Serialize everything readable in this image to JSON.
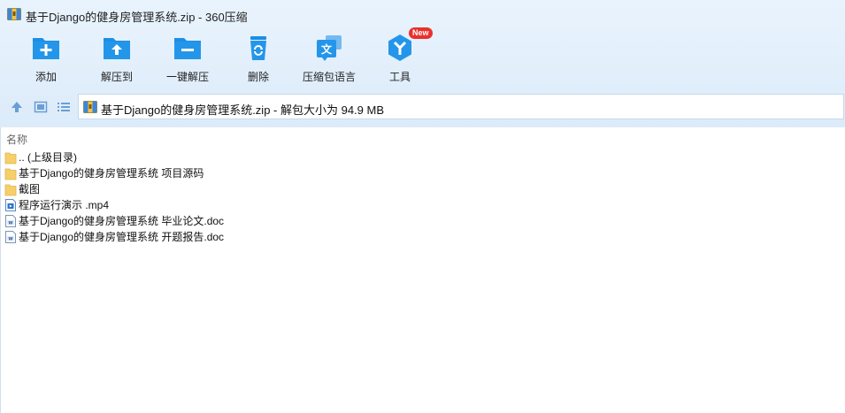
{
  "window": {
    "title": "基于Django的健身房管理系统.zip - 360压缩"
  },
  "toolbar": {
    "buttons": [
      {
        "label": "添加",
        "icon": "add-folder-icon"
      },
      {
        "label": "解压到",
        "icon": "extract-to-icon"
      },
      {
        "label": "一键解压",
        "icon": "one-click-extract-icon"
      },
      {
        "label": "删除",
        "icon": "delete-bin-icon"
      },
      {
        "label": "压缩包语言",
        "icon": "archive-language-icon"
      },
      {
        "label": "工具",
        "icon": "tools-icon",
        "badge": "New"
      }
    ]
  },
  "address": {
    "text": "基于Django的健身房管理系统.zip - 解包大小为 94.9 MB"
  },
  "list": {
    "header": "名称",
    "items": [
      {
        "name": ".. (上级目录)",
        "type": "folder",
        "icon": "folder-icon"
      },
      {
        "name": "基于Django的健身房管理系统 项目源码",
        "type": "folder",
        "icon": "folder-icon"
      },
      {
        "name": "截图",
        "type": "folder",
        "icon": "folder-icon"
      },
      {
        "name": "程序运行演示  .mp4",
        "type": "video",
        "icon": "video-file-icon"
      },
      {
        "name": "基于Django的健身房管理系统 毕业论文.doc",
        "type": "doc",
        "icon": "word-doc-icon"
      },
      {
        "name": "基于Django的健身房管理系统 开题报告.doc",
        "type": "doc",
        "icon": "word-doc-icon"
      }
    ]
  },
  "colors": {
    "accent": "#1a8ee0",
    "badge": "#e8312e",
    "folder": "#f6cf6a"
  }
}
